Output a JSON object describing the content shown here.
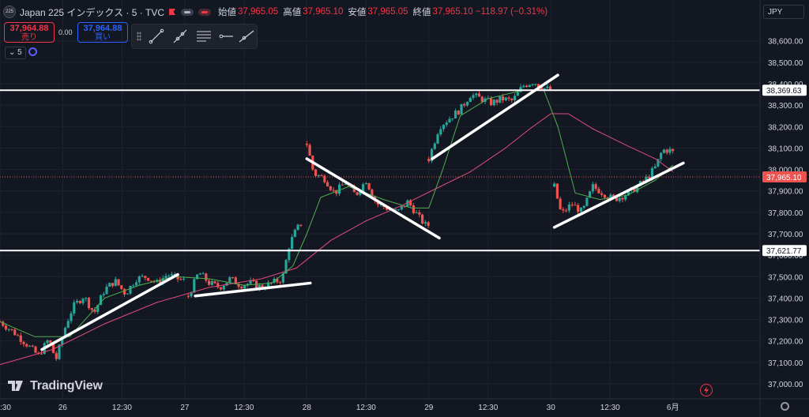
{
  "header": {
    "symbol_badge": "225",
    "symbol": "Japan 225 インデックス · 5 · TVC",
    "ohlc": [
      {
        "label": "始値",
        "value": "37,965.05"
      },
      {
        "label": "高値",
        "value": "37,965.10"
      },
      {
        "label": "安値",
        "value": "37,965.05"
      },
      {
        "label": "終値",
        "value": "37,965.10 −118.97 (−0.31%)"
      }
    ]
  },
  "trade": {
    "sell_price": "37,964.88",
    "sell_label": "売り",
    "spread": "0.00",
    "buy_price": "37,964.88",
    "buy_label": "買い"
  },
  "interval": "5",
  "currency": "JPY",
  "brand": "TradingView",
  "colors": {
    "background": "#131722",
    "up": "#26a69a",
    "down": "#ef5350",
    "ma_fast": "#4caf50",
    "ma_slow": "#e04b7a",
    "price_line": "#ef5350",
    "drawn_lines": "#ffffff"
  },
  "chart_data": {
    "type": "candlestick",
    "ylim": [
      36930,
      38680
    ],
    "y_ticks": [
      "38,600.00",
      "38,500.00",
      "38,400.00",
      "38,300.00",
      "38,200.00",
      "38,100.00",
      "38,000.00",
      "37,900.00",
      "37,800.00",
      "37,700.00",
      "37,600.00",
      "37,500.00",
      "37,400.00",
      "37,300.00",
      "37,200.00",
      "37,100.00",
      "37,000.00"
    ],
    "x_labels": [
      {
        "label": ":30",
        "t": 0
      },
      {
        "label": "26",
        "t": 18
      },
      {
        "label": "12:30",
        "t": 35
      },
      {
        "label": "27",
        "t": 53
      },
      {
        "label": "12:30",
        "t": 70
      },
      {
        "label": "28",
        "t": 88
      },
      {
        "label": "12:30",
        "t": 105
      },
      {
        "label": "29",
        "t": 123
      },
      {
        "label": "12:30",
        "t": 140
      },
      {
        "label": "30",
        "t": 158
      },
      {
        "label": "12:30",
        "t": 175
      },
      {
        "label": "6月",
        "t": 193
      }
    ],
    "t_range": [
      0,
      218
    ],
    "sessions": [
      {
        "t0": 0,
        "t1": 53,
        "path": [
          [
            0,
            37290
          ],
          [
            4,
            37240
          ],
          [
            8,
            37180
          ],
          [
            11,
            37130
          ],
          [
            14,
            37210
          ],
          [
            16,
            37110
          ],
          [
            19,
            37280
          ],
          [
            21,
            37360
          ],
          [
            24,
            37410
          ],
          [
            27,
            37330
          ],
          [
            30,
            37440
          ],
          [
            33,
            37480
          ],
          [
            36,
            37420
          ],
          [
            39,
            37490
          ],
          [
            42,
            37500
          ],
          [
            45,
            37470
          ],
          [
            48,
            37510
          ],
          [
            51,
            37490
          ],
          [
            53,
            37480
          ]
        ]
      },
      {
        "t0": 54,
        "t1": 87,
        "path": [
          [
            54,
            37410
          ],
          [
            57,
            37520
          ],
          [
            60,
            37470
          ],
          [
            63,
            37450
          ],
          [
            66,
            37490
          ],
          [
            69,
            37460
          ],
          [
            72,
            37470
          ],
          [
            75,
            37450
          ],
          [
            78,
            37470
          ],
          [
            81,
            37490
          ],
          [
            83,
            37650
          ],
          [
            85,
            37720
          ],
          [
            87,
            37760
          ]
        ]
      },
      {
        "t0": 88,
        "t1": 123,
        "path": [
          [
            88,
            38120
          ],
          [
            90,
            37980
          ],
          [
            93,
            37960
          ],
          [
            96,
            37890
          ],
          [
            99,
            37940
          ],
          [
            102,
            37880
          ],
          [
            105,
            37950
          ],
          [
            108,
            37840
          ],
          [
            111,
            37820
          ],
          [
            114,
            37800
          ],
          [
            117,
            37850
          ],
          [
            120,
            37780
          ],
          [
            122,
            37740
          ]
        ]
      },
      {
        "t0": 123,
        "t1": 158,
        "path": [
          [
            123,
            38050
          ],
          [
            126,
            38200
          ],
          [
            129,
            38240
          ],
          [
            132,
            38280
          ],
          [
            135,
            38350
          ],
          [
            138,
            38330
          ],
          [
            141,
            38310
          ],
          [
            144,
            38330
          ],
          [
            147,
            38320
          ],
          [
            150,
            38390
          ],
          [
            153,
            38410
          ],
          [
            156,
            38380
          ],
          [
            158,
            38370
          ]
        ]
      },
      {
        "t0": 159,
        "t1": 193,
        "path": [
          [
            159,
            37920
          ],
          [
            161,
            37790
          ],
          [
            164,
            37840
          ],
          [
            167,
            37800
          ],
          [
            170,
            37920
          ],
          [
            173,
            37890
          ],
          [
            176,
            37860
          ],
          [
            179,
            37880
          ],
          [
            182,
            37910
          ],
          [
            185,
            37950
          ],
          [
            188,
            38010
          ],
          [
            190,
            38090
          ],
          [
            192,
            38090
          ],
          [
            193,
            38080
          ]
        ]
      }
    ],
    "ma_fast": [
      [
        0,
        37290
      ],
      [
        10,
        37220
      ],
      [
        20,
        37220
      ],
      [
        30,
        37400
      ],
      [
        40,
        37460
      ],
      [
        50,
        37500
      ],
      [
        60,
        37490
      ],
      [
        70,
        37460
      ],
      [
        78,
        37470
      ],
      [
        84,
        37550
      ],
      [
        88,
        37700
      ],
      [
        92,
        37870
      ],
      [
        100,
        37920
      ],
      [
        110,
        37860
      ],
      [
        118,
        37820
      ],
      [
        123,
        37820
      ],
      [
        127,
        38000
      ],
      [
        132,
        38250
      ],
      [
        140,
        38330
      ],
      [
        150,
        38370
      ],
      [
        156,
        38370
      ],
      [
        160,
        38200
      ],
      [
        165,
        37890
      ],
      [
        172,
        37860
      ],
      [
        180,
        37880
      ],
      [
        188,
        37950
      ],
      [
        193,
        38020
      ]
    ],
    "ma_slow": [
      [
        0,
        37090
      ],
      [
        15,
        37160
      ],
      [
        30,
        37280
      ],
      [
        45,
        37380
      ],
      [
        60,
        37450
      ],
      [
        75,
        37490
      ],
      [
        85,
        37540
      ],
      [
        95,
        37670
      ],
      [
        105,
        37760
      ],
      [
        115,
        37830
      ],
      [
        125,
        37910
      ],
      [
        135,
        37990
      ],
      [
        145,
        38100
      ],
      [
        152,
        38190
      ],
      [
        158,
        38260
      ],
      [
        163,
        38260
      ],
      [
        170,
        38190
      ],
      [
        180,
        38110
      ],
      [
        188,
        38050
      ],
      [
        193,
        37990
      ]
    ],
    "h_lines": [
      {
        "label": "38,369.63",
        "y": 38369.63
      },
      {
        "label": "37,621.77",
        "y": 37621.77
      }
    ],
    "last_price": {
      "label": "37,965.10",
      "y": 37965.1
    },
    "trendlines": [
      {
        "t1": 12,
        "y1": 37160,
        "t2": 51,
        "y2": 37510
      },
      {
        "t1": 56,
        "y1": 37410,
        "t2": 89,
        "y2": 37470
      },
      {
        "t1": 88,
        "y1": 38050,
        "t2": 126,
        "y2": 37680
      },
      {
        "t1": 124,
        "y1": 38050,
        "t2": 160,
        "y2": 38440
      },
      {
        "t1": 159,
        "y1": 37730,
        "t2": 196,
        "y2": 38030
      }
    ]
  }
}
